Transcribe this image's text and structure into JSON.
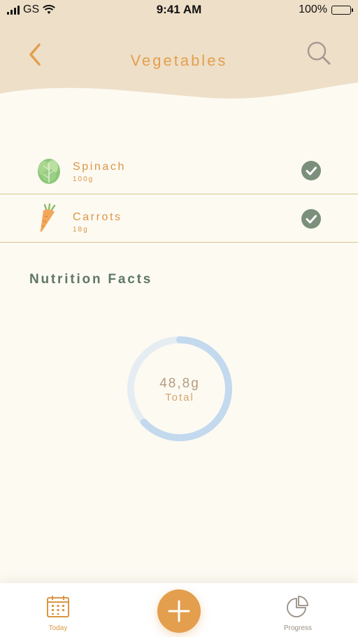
{
  "status_bar": {
    "carrier": "GS",
    "time": "9:41 AM",
    "battery": "100%"
  },
  "header": {
    "title": "Vegetables"
  },
  "foods": [
    {
      "name": "Spinach",
      "weight": "100g",
      "icon": "lettuce-icon",
      "checked": true
    },
    {
      "name": "Carrots",
      "weight": "18g",
      "icon": "carrot-icon",
      "checked": true
    }
  ],
  "nutrition": {
    "title": "Nutrition Facts",
    "total_value": "48,8g",
    "total_label": "Total",
    "progress": 0.63
  },
  "tabbar": {
    "today_label": "Today",
    "progress_label": "Progress"
  },
  "colors": {
    "accent": "#e39f4e",
    "header_bg": "#eedfc8",
    "check": "#7b8f7a",
    "ring": "#c3d9ee",
    "ring_track": "#e6edf2"
  }
}
